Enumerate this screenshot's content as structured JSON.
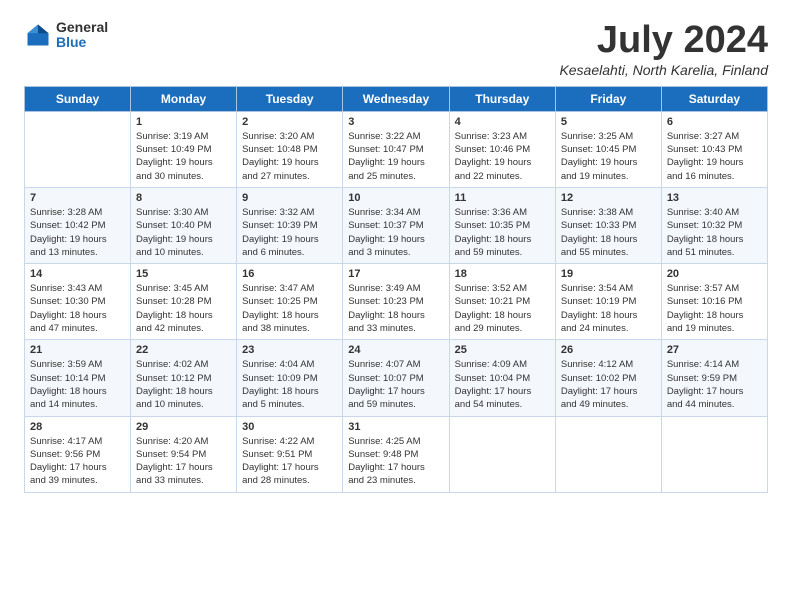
{
  "header": {
    "logo": {
      "general": "General",
      "blue": "Blue"
    },
    "title": "July 2024",
    "location": "Kesaelahti, North Karelia, Finland"
  },
  "weekdays": [
    "Sunday",
    "Monday",
    "Tuesday",
    "Wednesday",
    "Thursday",
    "Friday",
    "Saturday"
  ],
  "weeks": [
    [
      {
        "day": "",
        "info": ""
      },
      {
        "day": "1",
        "info": "Sunrise: 3:19 AM\nSunset: 10:49 PM\nDaylight: 19 hours\nand 30 minutes."
      },
      {
        "day": "2",
        "info": "Sunrise: 3:20 AM\nSunset: 10:48 PM\nDaylight: 19 hours\nand 27 minutes."
      },
      {
        "day": "3",
        "info": "Sunrise: 3:22 AM\nSunset: 10:47 PM\nDaylight: 19 hours\nand 25 minutes."
      },
      {
        "day": "4",
        "info": "Sunrise: 3:23 AM\nSunset: 10:46 PM\nDaylight: 19 hours\nand 22 minutes."
      },
      {
        "day": "5",
        "info": "Sunrise: 3:25 AM\nSunset: 10:45 PM\nDaylight: 19 hours\nand 19 minutes."
      },
      {
        "day": "6",
        "info": "Sunrise: 3:27 AM\nSunset: 10:43 PM\nDaylight: 19 hours\nand 16 minutes."
      }
    ],
    [
      {
        "day": "7",
        "info": "Sunrise: 3:28 AM\nSunset: 10:42 PM\nDaylight: 19 hours\nand 13 minutes."
      },
      {
        "day": "8",
        "info": "Sunrise: 3:30 AM\nSunset: 10:40 PM\nDaylight: 19 hours\nand 10 minutes."
      },
      {
        "day": "9",
        "info": "Sunrise: 3:32 AM\nSunset: 10:39 PM\nDaylight: 19 hours\nand 6 minutes."
      },
      {
        "day": "10",
        "info": "Sunrise: 3:34 AM\nSunset: 10:37 PM\nDaylight: 19 hours\nand 3 minutes."
      },
      {
        "day": "11",
        "info": "Sunrise: 3:36 AM\nSunset: 10:35 PM\nDaylight: 18 hours\nand 59 minutes."
      },
      {
        "day": "12",
        "info": "Sunrise: 3:38 AM\nSunset: 10:33 PM\nDaylight: 18 hours\nand 55 minutes."
      },
      {
        "day": "13",
        "info": "Sunrise: 3:40 AM\nSunset: 10:32 PM\nDaylight: 18 hours\nand 51 minutes."
      }
    ],
    [
      {
        "day": "14",
        "info": "Sunrise: 3:43 AM\nSunset: 10:30 PM\nDaylight: 18 hours\nand 47 minutes."
      },
      {
        "day": "15",
        "info": "Sunrise: 3:45 AM\nSunset: 10:28 PM\nDaylight: 18 hours\nand 42 minutes."
      },
      {
        "day": "16",
        "info": "Sunrise: 3:47 AM\nSunset: 10:25 PM\nDaylight: 18 hours\nand 38 minutes."
      },
      {
        "day": "17",
        "info": "Sunrise: 3:49 AM\nSunset: 10:23 PM\nDaylight: 18 hours\nand 33 minutes."
      },
      {
        "day": "18",
        "info": "Sunrise: 3:52 AM\nSunset: 10:21 PM\nDaylight: 18 hours\nand 29 minutes."
      },
      {
        "day": "19",
        "info": "Sunrise: 3:54 AM\nSunset: 10:19 PM\nDaylight: 18 hours\nand 24 minutes."
      },
      {
        "day": "20",
        "info": "Sunrise: 3:57 AM\nSunset: 10:16 PM\nDaylight: 18 hours\nand 19 minutes."
      }
    ],
    [
      {
        "day": "21",
        "info": "Sunrise: 3:59 AM\nSunset: 10:14 PM\nDaylight: 18 hours\nand 14 minutes."
      },
      {
        "day": "22",
        "info": "Sunrise: 4:02 AM\nSunset: 10:12 PM\nDaylight: 18 hours\nand 10 minutes."
      },
      {
        "day": "23",
        "info": "Sunrise: 4:04 AM\nSunset: 10:09 PM\nDaylight: 18 hours\nand 5 minutes."
      },
      {
        "day": "24",
        "info": "Sunrise: 4:07 AM\nSunset: 10:07 PM\nDaylight: 17 hours\nand 59 minutes."
      },
      {
        "day": "25",
        "info": "Sunrise: 4:09 AM\nSunset: 10:04 PM\nDaylight: 17 hours\nand 54 minutes."
      },
      {
        "day": "26",
        "info": "Sunrise: 4:12 AM\nSunset: 10:02 PM\nDaylight: 17 hours\nand 49 minutes."
      },
      {
        "day": "27",
        "info": "Sunrise: 4:14 AM\nSunset: 9:59 PM\nDaylight: 17 hours\nand 44 minutes."
      }
    ],
    [
      {
        "day": "28",
        "info": "Sunrise: 4:17 AM\nSunset: 9:56 PM\nDaylight: 17 hours\nand 39 minutes."
      },
      {
        "day": "29",
        "info": "Sunrise: 4:20 AM\nSunset: 9:54 PM\nDaylight: 17 hours\nand 33 minutes."
      },
      {
        "day": "30",
        "info": "Sunrise: 4:22 AM\nSunset: 9:51 PM\nDaylight: 17 hours\nand 28 minutes."
      },
      {
        "day": "31",
        "info": "Sunrise: 4:25 AM\nSunset: 9:48 PM\nDaylight: 17 hours\nand 23 minutes."
      },
      {
        "day": "",
        "info": ""
      },
      {
        "day": "",
        "info": ""
      },
      {
        "day": "",
        "info": ""
      }
    ]
  ]
}
